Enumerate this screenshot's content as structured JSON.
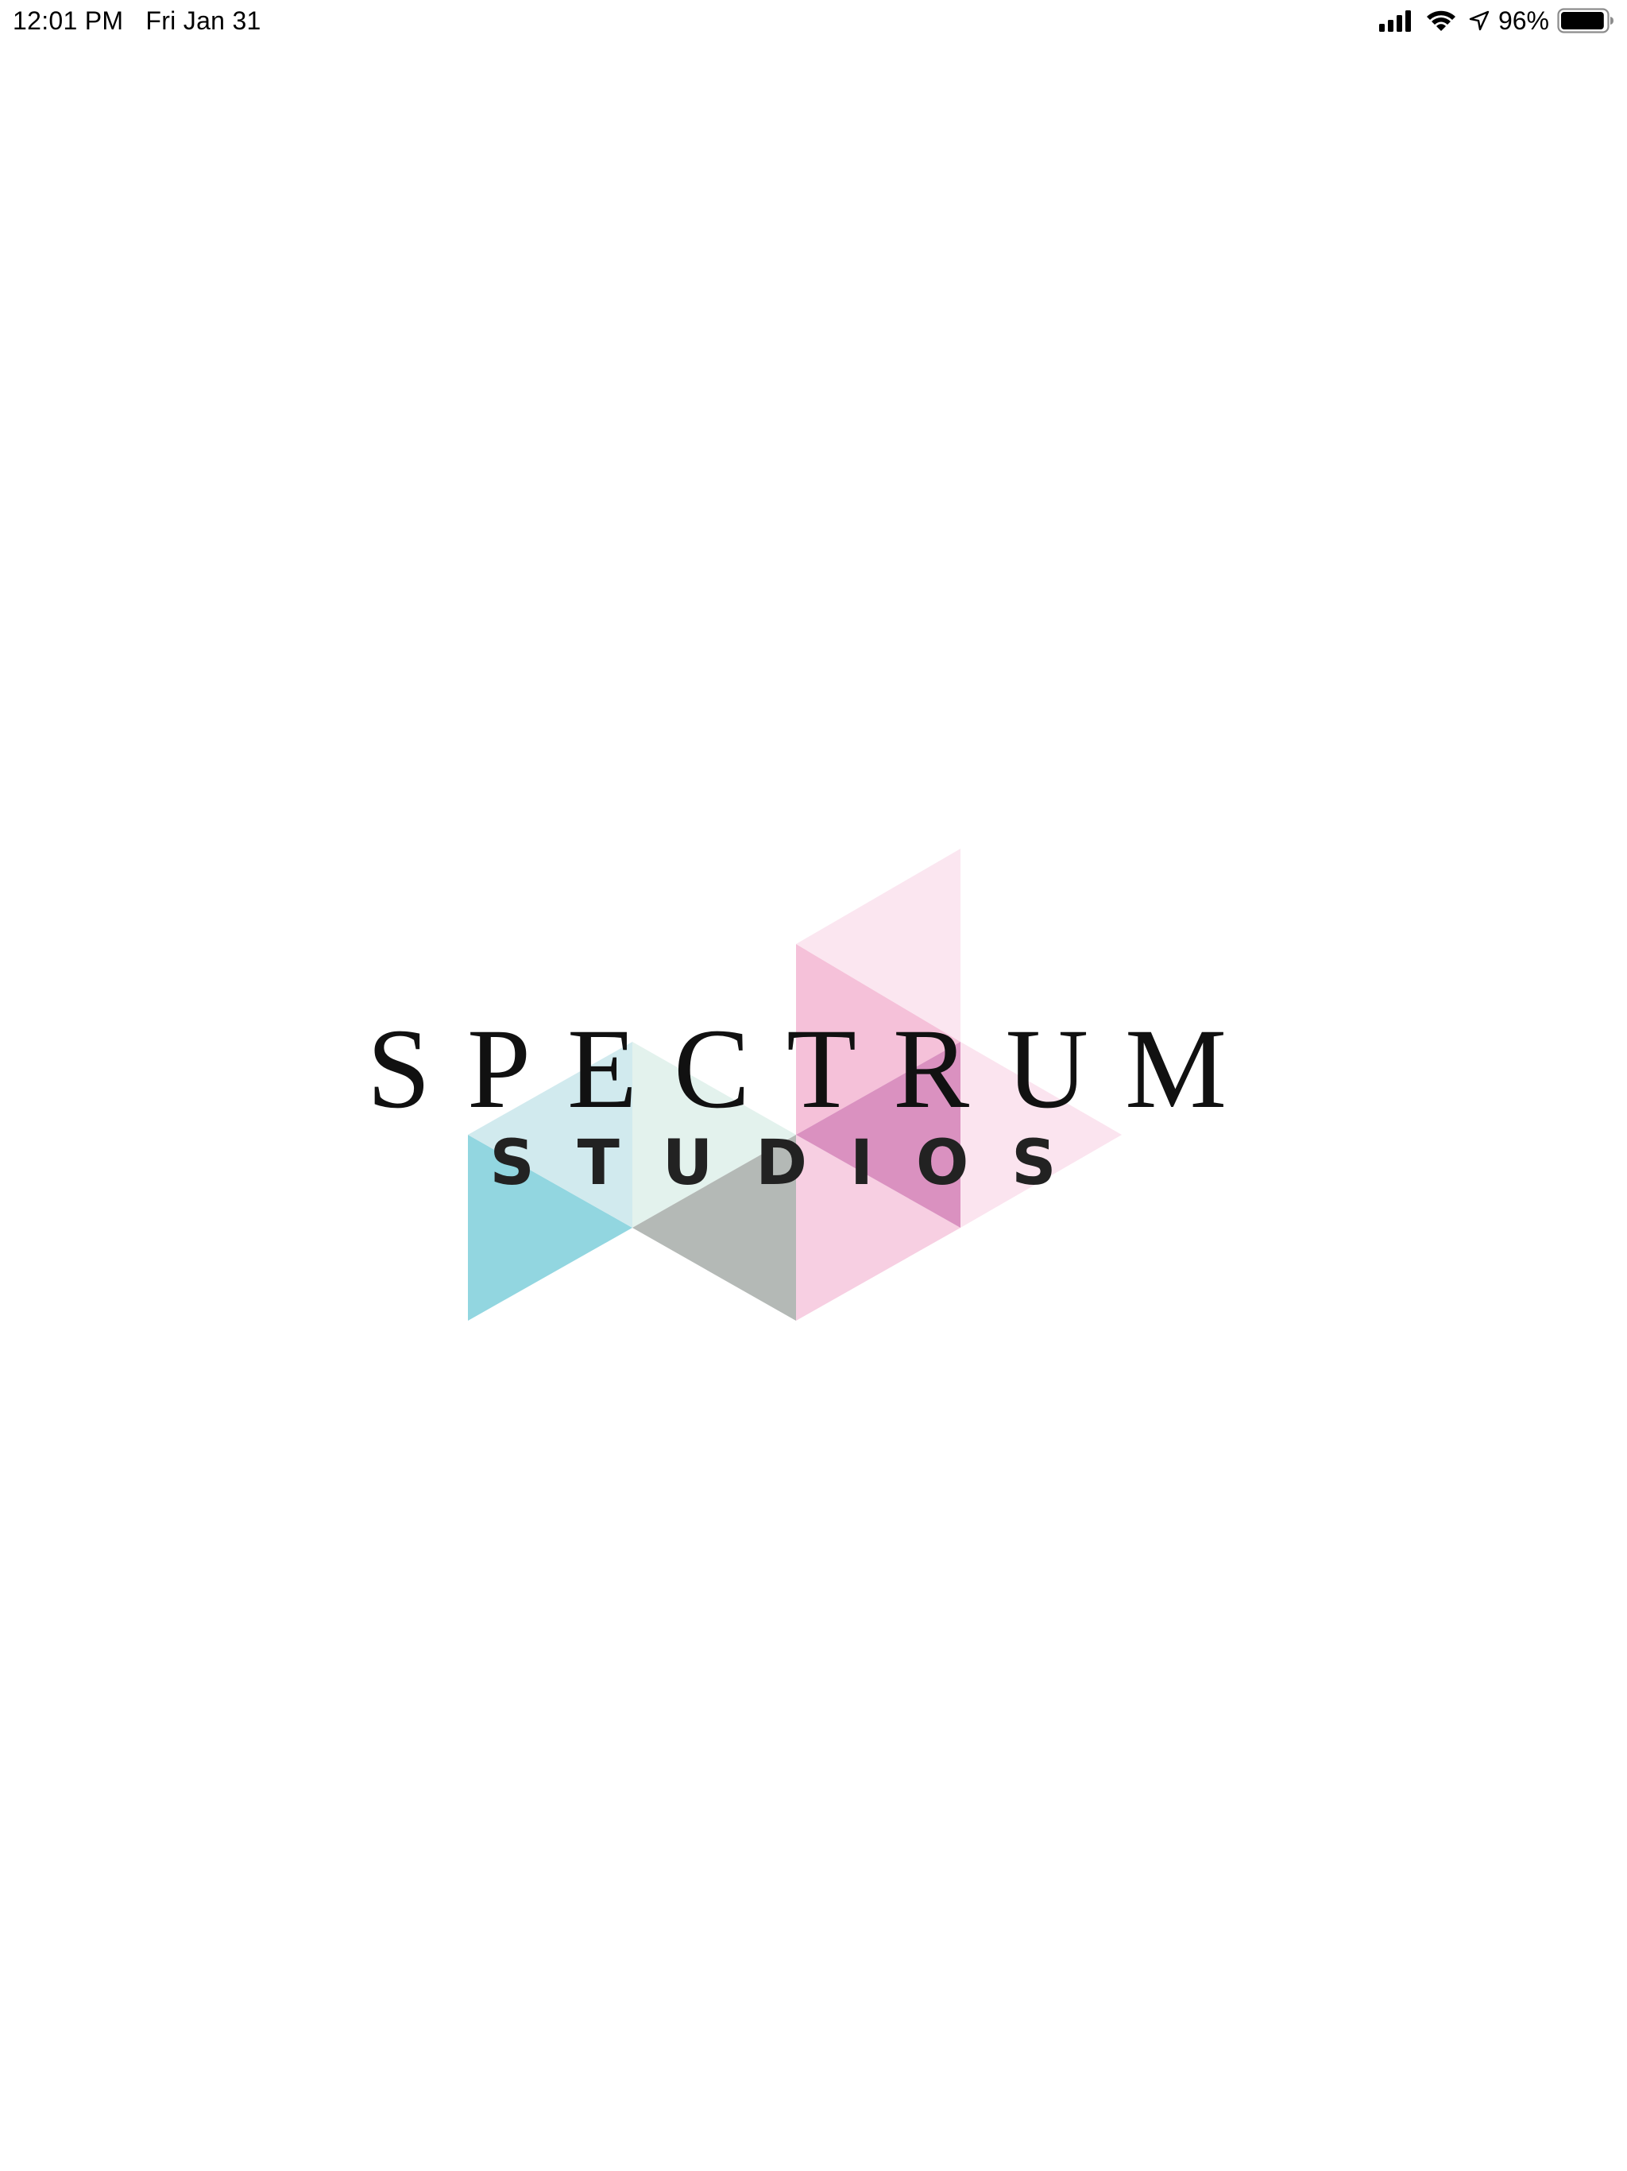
{
  "status_bar": {
    "time": "12:01 PM",
    "date": "Fri Jan 31",
    "battery_percent": "96%",
    "battery_level": 0.96,
    "icons": [
      "cellular-signal-icon",
      "wifi-icon",
      "location-arrow-icon",
      "battery-icon"
    ]
  },
  "logo": {
    "wordmark": "SPECTRUM",
    "subtitle": "STUDIOS",
    "colors": {
      "teal": "#7fcfdb",
      "light_teal": "#cfe9ed",
      "mint": "#e2f1ec",
      "gray": "#b4b9b6",
      "pink": "#f3b6d2",
      "light_pink": "#fadbe9",
      "magenta": "#d88bbd"
    }
  }
}
